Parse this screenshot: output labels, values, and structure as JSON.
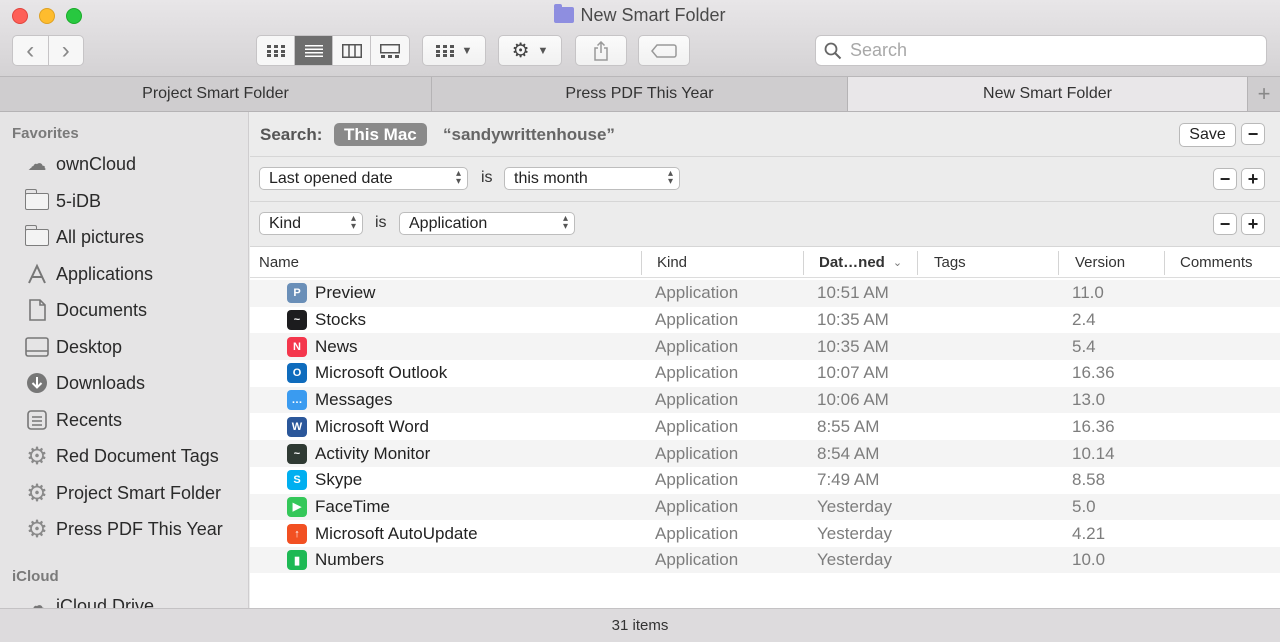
{
  "window": {
    "title": "New Smart Folder"
  },
  "toolbar": {
    "back_glyph": "‹",
    "forward_glyph": "›",
    "search_placeholder": "Search"
  },
  "tabs": [
    {
      "label": "Project Smart Folder"
    },
    {
      "label": "Press PDF This Year"
    },
    {
      "label": "New Smart Folder"
    }
  ],
  "tab_add_glyph": "+",
  "sidebar": {
    "favorites_heading": "Favorites",
    "favorites": [
      {
        "label": "ownCloud",
        "icon": "cloud-icon"
      },
      {
        "label": "5-iDB",
        "icon": "folder-icon"
      },
      {
        "label": "All pictures",
        "icon": "folder-icon"
      },
      {
        "label": "Applications",
        "icon": "applications-icon"
      },
      {
        "label": "Documents",
        "icon": "document-icon"
      },
      {
        "label": "Desktop",
        "icon": "desktop-icon"
      },
      {
        "label": "Downloads",
        "icon": "download-icon"
      },
      {
        "label": "Recents",
        "icon": "recents-icon"
      },
      {
        "label": "Red Document Tags",
        "icon": "gear-icon"
      },
      {
        "label": "Project Smart Folder",
        "icon": "gear-icon"
      },
      {
        "label": "Press PDF This Year",
        "icon": "gear-icon"
      }
    ],
    "icloud_heading": "iCloud",
    "icloud": [
      {
        "label": "iCloud Drive",
        "icon": "cloud-icon"
      }
    ]
  },
  "search_bar": {
    "label": "Search:",
    "scope_this_mac": "This Mac",
    "scope_user": "“sandywrittenhouse”",
    "save_label": "Save",
    "minus": "−"
  },
  "criteria": [
    {
      "attribute": "Last opened date",
      "operator": "is",
      "value": "this month"
    },
    {
      "attribute": "Kind",
      "operator": "is",
      "value": "Application"
    }
  ],
  "criteria_buttons": {
    "minus": "−",
    "plus": "+"
  },
  "columns": {
    "name": "Name",
    "kind": "Kind",
    "date": "Dat…ned",
    "tags": "Tags",
    "version": "Version",
    "comments": "Comments"
  },
  "files": [
    {
      "name": "Preview",
      "kind": "Application",
      "date": "10:51 AM",
      "version": "11.0",
      "icon": "preview-icon",
      "color": "#6a8fb8",
      "glyph": "P"
    },
    {
      "name": "Stocks",
      "kind": "Application",
      "date": "10:35 AM",
      "version": "2.4",
      "icon": "stocks-icon",
      "color": "#1c1c1e",
      "glyph": "~"
    },
    {
      "name": "News",
      "kind": "Application",
      "date": "10:35 AM",
      "version": "5.4",
      "icon": "news-icon",
      "color": "#f4364c",
      "glyph": "N"
    },
    {
      "name": "Microsoft Outlook",
      "kind": "Application",
      "date": "10:07 AM",
      "version": "16.36",
      "icon": "outlook-icon",
      "color": "#0f6cbd",
      "glyph": "O"
    },
    {
      "name": "Messages",
      "kind": "Application",
      "date": "10:06 AM",
      "version": "13.0",
      "icon": "messages-icon",
      "color": "#3a9bf0",
      "glyph": "…"
    },
    {
      "name": "Microsoft Word",
      "kind": "Application",
      "date": "8:55 AM",
      "version": "16.36",
      "icon": "word-icon",
      "color": "#2b579a",
      "glyph": "W"
    },
    {
      "name": "Activity Monitor",
      "kind": "Application",
      "date": "8:54 AM",
      "version": "10.14",
      "icon": "activity-monitor-icon",
      "color": "#2f3a33",
      "glyph": "~"
    },
    {
      "name": "Skype",
      "kind": "Application",
      "date": "7:49 AM",
      "version": "8.58",
      "icon": "skype-icon",
      "color": "#00aff0",
      "glyph": "S"
    },
    {
      "name": "FaceTime",
      "kind": "Application",
      "date": "Yesterday",
      "version": "5.0",
      "icon": "facetime-icon",
      "color": "#34c759",
      "glyph": "▶"
    },
    {
      "name": "Microsoft AutoUpdate",
      "kind": "Application",
      "date": "Yesterday",
      "version": "4.21",
      "icon": "autoupdate-icon",
      "color": "#f25022",
      "glyph": "↑"
    },
    {
      "name": "Numbers",
      "kind": "Application",
      "date": "Yesterday",
      "version": "10.0",
      "icon": "numbers-icon",
      "color": "#1db954",
      "glyph": "▮"
    }
  ],
  "status": {
    "items": "31 items"
  }
}
